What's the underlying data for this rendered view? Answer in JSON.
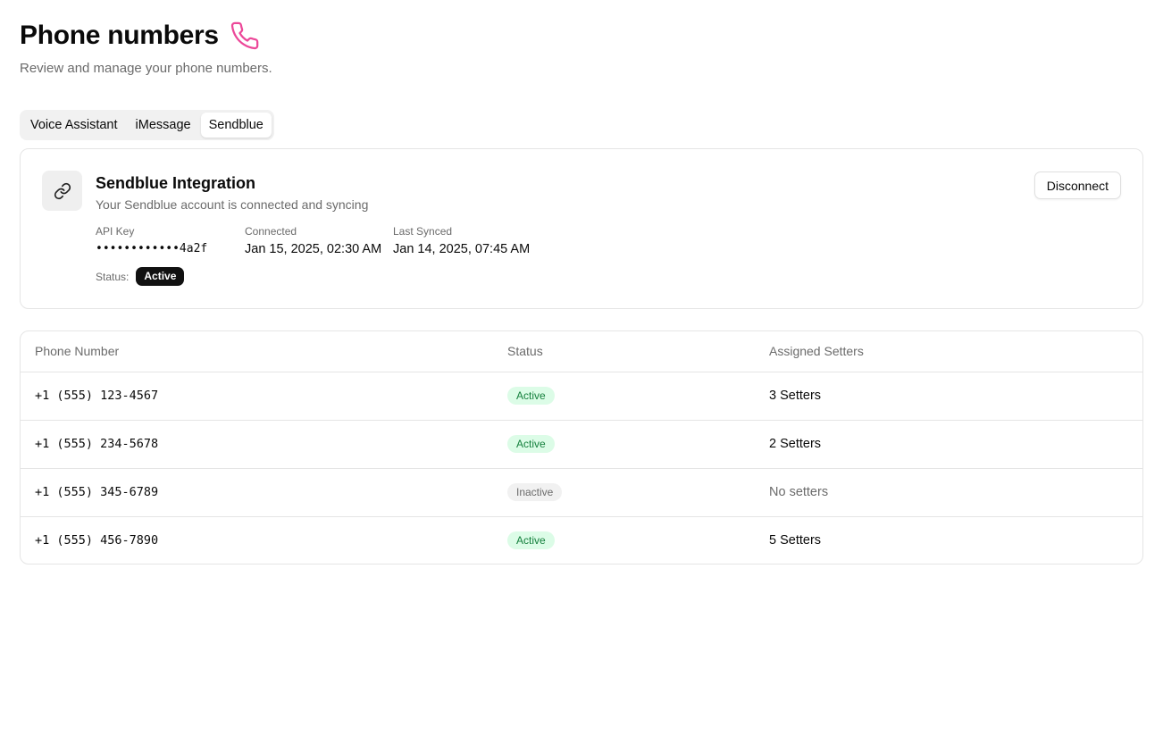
{
  "header": {
    "title": "Phone numbers",
    "subtitle": "Review and manage your phone numbers.",
    "icon": "phone-icon",
    "icon_color": "#ec4899"
  },
  "tabs": [
    {
      "label": "Voice Assistant",
      "active": false
    },
    {
      "label": "iMessage",
      "active": false
    },
    {
      "label": "Sendblue",
      "active": true
    }
  ],
  "integration": {
    "icon": "link-icon",
    "title": "Sendblue Integration",
    "description": "Your Sendblue account is connected and syncing",
    "api_key_label": "API Key",
    "api_key_value": "••••••••••••4a2f",
    "connected_label": "Connected",
    "connected_value": "Jan 15, 2025, 02:30 AM",
    "synced_label": "Last Synced",
    "synced_value": "Jan 14, 2025, 07:45 AM",
    "status_label": "Status:",
    "status_value": "Active",
    "disconnect_label": "Disconnect"
  },
  "table": {
    "headers": [
      "Phone Number",
      "Status",
      "Assigned Setters"
    ],
    "rows": [
      {
        "phone": "+1 (555) 123-4567",
        "status": "Active",
        "setters": "3 Setters"
      },
      {
        "phone": "+1 (555) 234-5678",
        "status": "Active",
        "setters": "2 Setters"
      },
      {
        "phone": "+1 (555) 345-6789",
        "status": "Inactive",
        "setters": "No setters"
      },
      {
        "phone": "+1 (555) 456-7890",
        "status": "Active",
        "setters": "5 Setters"
      }
    ]
  },
  "colors": {
    "active_bg": "#dcfce7",
    "active_text": "#15803d",
    "inactive_bg": "#f1f1f1"
  }
}
